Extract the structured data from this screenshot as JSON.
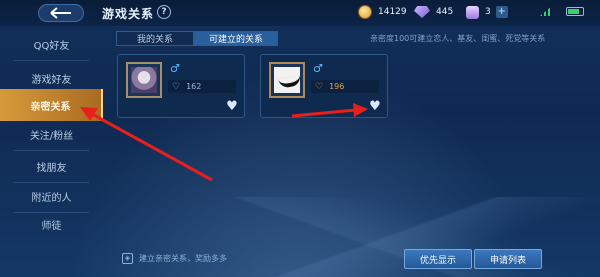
{
  "topbar": {
    "title": "游戏关系",
    "help": "?",
    "coins": "14129",
    "gems": "445",
    "bag": "3"
  },
  "sidebar": {
    "items": [
      {
        "label": "QQ好友"
      },
      {
        "label": "游戏好友"
      },
      {
        "label": "亲密关系"
      },
      {
        "label": "关注/粉丝"
      },
      {
        "label": "找朋友"
      },
      {
        "label": "附近的人"
      },
      {
        "label": "师徒"
      }
    ]
  },
  "tabs": [
    {
      "label": "我的关系"
    },
    {
      "label": "可建立的关系"
    }
  ],
  "hint": "亲密度100可建立恋人、基友、闺蜜、死党等关系",
  "cards": [
    {
      "gender": "♂",
      "intimacy": "162"
    },
    {
      "gender": "♂",
      "intimacy": "196"
    }
  ],
  "bottom": {
    "hint": "建立亲密关系，奖励多多",
    "priority_btn": "优先显示",
    "apply_btn": "申请列表"
  },
  "colors": {
    "accent_active": "#d79b3c",
    "annotation_arrow": "#e8201c",
    "button": "#3b78c0"
  }
}
